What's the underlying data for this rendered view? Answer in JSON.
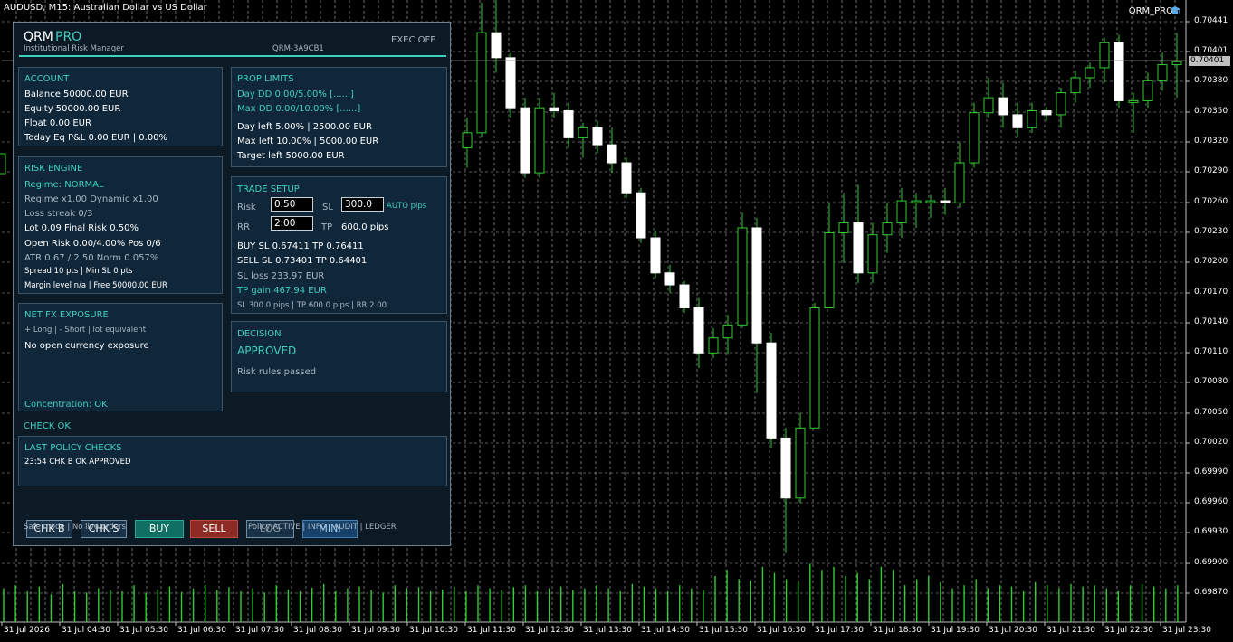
{
  "window": {
    "title": "AUDUSD, M15:  Australian Dollar vs US Dollar",
    "ea_name": "QRM_PRO"
  },
  "chart_data": {
    "type": "candlestick",
    "symbol": "AUDUSD",
    "timeframe": "M15",
    "grid": true,
    "y_ticks": [
      "0.70441",
      "0.70401",
      "0.70380",
      "0.70350",
      "0.70320",
      "0.70290",
      "0.70260",
      "0.70230",
      "0.70200",
      "0.70170",
      "0.70140",
      "0.70110",
      "0.70080",
      "0.70050",
      "0.70020",
      "0.69990",
      "0.69960",
      "0.69930",
      "0.69900",
      "0.69870"
    ],
    "current_price": "0.70401",
    "x_ticks": [
      "31 Jul 2026",
      "31 Jul 04:30",
      "31 Jul 05:30",
      "31 Jul 06:30",
      "31 Jul 07:30",
      "31 Jul 08:30",
      "31 Jul 09:30",
      "31 Jul 10:30",
      "31 Jul 11:30",
      "31 Jul 12:30",
      "31 Jul 13:30",
      "31 Jul 14:30",
      "31 Jul 15:30",
      "31 Jul 16:30",
      "31 Jul 17:30",
      "31 Jul 18:30",
      "31 Jul 19:30",
      "31 Jul 20:30",
      "31 Jul 21:30",
      "31 Jul 22:30",
      "31 Jul 23:30"
    ],
    "candles": [
      {
        "o": 0.70315,
        "h": 0.70345,
        "l": 0.70295,
        "c": 0.7033
      },
      {
        "o": 0.7033,
        "h": 0.7046,
        "l": 0.70325,
        "c": 0.7043
      },
      {
        "o": 0.7043,
        "h": 0.7047,
        "l": 0.7039,
        "c": 0.70405
      },
      {
        "o": 0.70405,
        "h": 0.7041,
        "l": 0.70345,
        "c": 0.70355
      },
      {
        "o": 0.70355,
        "h": 0.70365,
        "l": 0.70285,
        "c": 0.7029
      },
      {
        "o": 0.7029,
        "h": 0.70365,
        "l": 0.70285,
        "c": 0.70355
      },
      {
        "o": 0.70355,
        "h": 0.7037,
        "l": 0.70345,
        "c": 0.70352
      },
      {
        "o": 0.70352,
        "h": 0.7036,
        "l": 0.70315,
        "c": 0.70325
      },
      {
        "o": 0.70325,
        "h": 0.7034,
        "l": 0.70305,
        "c": 0.70335
      },
      {
        "o": 0.70335,
        "h": 0.70342,
        "l": 0.7031,
        "c": 0.70318
      },
      {
        "o": 0.70318,
        "h": 0.70335,
        "l": 0.7029,
        "c": 0.703
      },
      {
        "o": 0.703,
        "h": 0.70305,
        "l": 0.70265,
        "c": 0.7027
      },
      {
        "o": 0.7027,
        "h": 0.70275,
        "l": 0.7022,
        "c": 0.70225
      },
      {
        "o": 0.70225,
        "h": 0.70232,
        "l": 0.70185,
        "c": 0.7019
      },
      {
        "o": 0.7019,
        "h": 0.70198,
        "l": 0.7017,
        "c": 0.70178
      },
      {
        "o": 0.70178,
        "h": 0.70182,
        "l": 0.7015,
        "c": 0.70155
      },
      {
        "o": 0.70155,
        "h": 0.70165,
        "l": 0.70095,
        "c": 0.7011
      },
      {
        "o": 0.7011,
        "h": 0.70135,
        "l": 0.70105,
        "c": 0.70125
      },
      {
        "o": 0.70125,
        "h": 0.70148,
        "l": 0.70108,
        "c": 0.70138
      },
      {
        "o": 0.70138,
        "h": 0.7025,
        "l": 0.70135,
        "c": 0.70235
      },
      {
        "o": 0.70235,
        "h": 0.70245,
        "l": 0.7007,
        "c": 0.7012
      },
      {
        "o": 0.7012,
        "h": 0.7013,
        "l": 0.70015,
        "c": 0.70025
      },
      {
        "o": 0.70025,
        "h": 0.70035,
        "l": 0.6991,
        "c": 0.69965
      },
      {
        "o": 0.69965,
        "h": 0.7005,
        "l": 0.6996,
        "c": 0.70035
      },
      {
        "o": 0.70035,
        "h": 0.7016,
        "l": 0.70035,
        "c": 0.70155
      },
      {
        "o": 0.70155,
        "h": 0.7026,
        "l": 0.70155,
        "c": 0.7023
      },
      {
        "o": 0.7023,
        "h": 0.7027,
        "l": 0.702,
        "c": 0.7024
      },
      {
        "o": 0.7024,
        "h": 0.70278,
        "l": 0.7018,
        "c": 0.7019
      },
      {
        "o": 0.7019,
        "h": 0.7024,
        "l": 0.7018,
        "c": 0.70228
      },
      {
        "o": 0.70228,
        "h": 0.7026,
        "l": 0.7021,
        "c": 0.7024
      },
      {
        "o": 0.7024,
        "h": 0.70275,
        "l": 0.70225,
        "c": 0.70262
      },
      {
        "o": 0.70262,
        "h": 0.7027,
        "l": 0.70235,
        "c": 0.70262
      },
      {
        "o": 0.70262,
        "h": 0.70268,
        "l": 0.70245,
        "c": 0.70262
      },
      {
        "o": 0.70262,
        "h": 0.70275,
        "l": 0.70248,
        "c": 0.7026
      },
      {
        "o": 0.7026,
        "h": 0.7032,
        "l": 0.70255,
        "c": 0.703
      },
      {
        "o": 0.703,
        "h": 0.7036,
        "l": 0.70295,
        "c": 0.7035
      },
      {
        "o": 0.7035,
        "h": 0.70385,
        "l": 0.70345,
        "c": 0.70365
      },
      {
        "o": 0.70365,
        "h": 0.7038,
        "l": 0.70335,
        "c": 0.70348
      },
      {
        "o": 0.70348,
        "h": 0.7036,
        "l": 0.70325,
        "c": 0.70335
      },
      {
        "o": 0.70335,
        "h": 0.7036,
        "l": 0.7033,
        "c": 0.70352
      },
      {
        "o": 0.70352,
        "h": 0.70356,
        "l": 0.70342,
        "c": 0.70348
      },
      {
        "o": 0.70348,
        "h": 0.70375,
        "l": 0.70335,
        "c": 0.7037
      },
      {
        "o": 0.7037,
        "h": 0.70392,
        "l": 0.7036,
        "c": 0.70385
      },
      {
        "o": 0.70385,
        "h": 0.704,
        "l": 0.70375,
        "c": 0.70395
      },
      {
        "o": 0.70395,
        "h": 0.70425,
        "l": 0.7038,
        "c": 0.7042
      },
      {
        "o": 0.7042,
        "h": 0.70428,
        "l": 0.70355,
        "c": 0.70362
      },
      {
        "o": 0.70362,
        "h": 0.7037,
        "l": 0.7033,
        "c": 0.70362
      },
      {
        "o": 0.70362,
        "h": 0.7039,
        "l": 0.70355,
        "c": 0.70382
      },
      {
        "o": 0.70382,
        "h": 0.7041,
        "l": 0.70372,
        "c": 0.70398
      },
      {
        "o": 0.70398,
        "h": 0.7043,
        "l": 0.70365,
        "c": 0.70401
      }
    ],
    "volumes": [
      0.55,
      0.6,
      0.5,
      0.58,
      0.45,
      0.62,
      0.5,
      0.48,
      0.55,
      0.52,
      0.5,
      0.6,
      0.47,
      0.53,
      0.58,
      0.49,
      0.55,
      0.6,
      0.52,
      0.57,
      0.5,
      0.55,
      0.48,
      0.6,
      0.53,
      0.5,
      0.56,
      0.62,
      0.5,
      0.55,
      0.58,
      0.52,
      0.48,
      0.6,
      0.55,
      0.57,
      0.5,
      0.53,
      0.58,
      0.5,
      0.6,
      0.55,
      0.52,
      0.57,
      0.6,
      0.5,
      0.55,
      0.58,
      0.52,
      0.55,
      0.6,
      0.55,
      0.5,
      0.62,
      0.58,
      0.55,
      0.5,
      0.6,
      0.55,
      0.52,
      0.75,
      0.85,
      0.7,
      0.68,
      0.9,
      0.8,
      0.7,
      0.65,
      0.95,
      0.85,
      0.9,
      0.75,
      0.8,
      0.7,
      0.9,
      0.85,
      0.6,
      0.7,
      0.75,
      0.65,
      0.55,
      0.6,
      0.7,
      0.55,
      0.6,
      0.58,
      0.5,
      0.65,
      0.6,
      0.55,
      0.62,
      0.58,
      0.6,
      0.55,
      0.5,
      0.6,
      0.62,
      0.58,
      0.55,
      0.6
    ]
  },
  "panel": {
    "brand": "QRM",
    "brand_suffix": "PRO",
    "subtitle": "Institutional Risk Manager",
    "code": "QRM-3A9CB1",
    "exec_status": "EXEC OFF",
    "account": {
      "title": "ACCOUNT",
      "balance": "Balance   50000.00 EUR",
      "equity": "Equity    50000.00 EUR",
      "float": "Float     0.00 EUR",
      "today_pnl": "Today Eq P&L 0.00 EUR | 0.00%"
    },
    "prop": {
      "title": "PROP LIMITS",
      "day_dd": "Day DD   0.00/5.00%  [......]",
      "max_dd": "Max DD   0.00/10.00%  [......]",
      "day_left": "Day left   5.00% | 2500.00 EUR",
      "max_left": "Max left   10.00% | 5000.00 EUR",
      "target_left": "Target left 5000.00 EUR"
    },
    "risk": {
      "title": "RISK ENGINE",
      "regime": "Regime: NORMAL",
      "regime_mult": "Regime x1.00   Dynamic x1.00",
      "loss_streak": "Loss streak 0/3",
      "lot": "Lot 0.09   Final Risk 0.50%",
      "open_risk": "Open Risk 0.00/4.00%   Pos 0/6",
      "atr": "ATR 0.67 / 2.50   Norm 0.057%",
      "spread": "Spread 10 pts  |  Min SL 0 pts",
      "margin": "Margin level n/a  |  Free 50000.00 EUR"
    },
    "trade": {
      "title": "TRADE SETUP",
      "risk_label": "Risk",
      "risk_value": "0.50",
      "sl_label": "SL",
      "sl_value": "300.0",
      "auto_label": "AUTO pips",
      "rr_label": "RR",
      "rr_value": "2.00",
      "tp_label": "TP",
      "tp_value": "600.0 pips",
      "buy_line": "BUY  SL 0.67411   TP 0.76411",
      "sell_line": "SELL SL 0.73401   TP 0.64401",
      "sl_loss": "SL loss 233.97 EUR",
      "tp_gain": "TP gain 467.94 EUR",
      "summary": "SL 300.0 pips  |  TP 600.0 pips  |  RR 2.00"
    },
    "exposure": {
      "title": "NET FX EXPOSURE",
      "legend": "+ Long  |  - Short  |  lot equivalent",
      "status": "No open currency exposure",
      "concentration": "Concentration: OK"
    },
    "decision": {
      "title": "DECISION",
      "value": "APPROVED",
      "note": "Risk rules passed"
    },
    "check": "CHECK OK",
    "policy": {
      "title": "LAST POLICY CHECKS",
      "entry": "23:54 CHK B OK APPROVED"
    },
    "buttons": {
      "chk_b": "CHK B",
      "chk_s": "CHK S",
      "buy": "BUY",
      "sell": "SELL",
      "log": "LOG",
      "mini": "MINI"
    },
    "footer_left": "Safe mode  |  No live orders",
    "footer_right": "Policy ACTIVE  |  INFO  |  AUDIT  |  LEDGER"
  }
}
